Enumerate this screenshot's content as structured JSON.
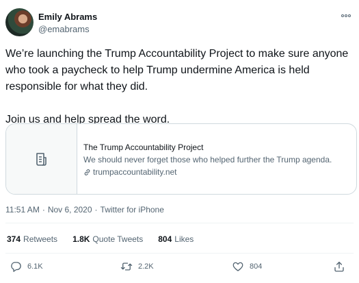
{
  "author": {
    "name": "Emily Abrams",
    "handle": "@emabrams"
  },
  "tweet": {
    "text": "We’re launching the Trump Accountability Project to make sure anyone who took a paycheck to help Trump undermine America is held responsible for what they did.\n\nJoin us and help spread the word."
  },
  "card": {
    "title": "The Trump Accountability Project",
    "description": "We should never forget those who helped further the Trump agenda.",
    "domain": "trumpaccountability.net",
    "thumb_icon": "document-icon",
    "link_icon": "link-icon"
  },
  "meta": {
    "time": "11:51 AM",
    "separator1": "·",
    "date": "Nov 6, 2020",
    "separator2": "·",
    "source": "Twitter for iPhone"
  },
  "stats": {
    "retweets_count": "374",
    "retweets_label": "Retweets",
    "quote_count": "1.8K",
    "quote_label": "Quote Tweets",
    "likes_count": "804",
    "likes_label": "Likes"
  },
  "actions": {
    "reply_count": "6.1K",
    "retweet_count": "2.2K",
    "like_count": "804",
    "reply_icon": "reply-icon",
    "retweet_icon": "retweet-icon",
    "like_icon": "heart-icon",
    "share_icon": "share-icon"
  },
  "more_icon": "more-icon"
}
